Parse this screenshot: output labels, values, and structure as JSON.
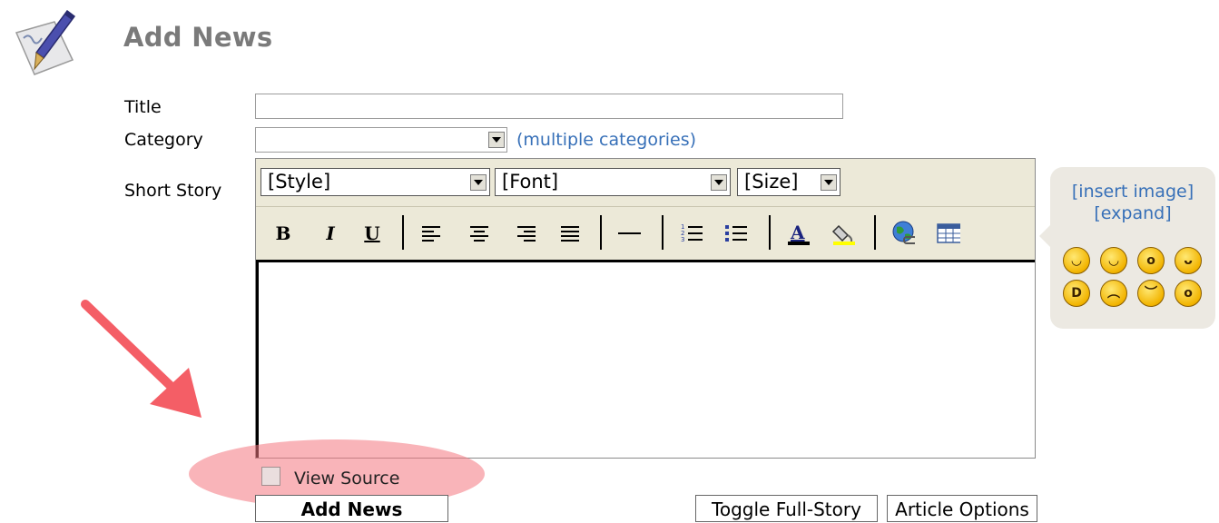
{
  "page": {
    "title": "Add News"
  },
  "form": {
    "title_label": "Title",
    "title_value": "",
    "category_label": "Category",
    "category_value": "",
    "multiple_categories_link": "(multiple categories)",
    "short_story_label": "Short Story"
  },
  "editor": {
    "style_select": "[Style]",
    "font_select": "[Font]",
    "size_select": "[Size]",
    "bold_label": "B",
    "italic_label": "I",
    "underline_label": "U",
    "content": ""
  },
  "side_panel": {
    "insert_image": "[insert image]",
    "expand": "[expand]",
    "smileys": [
      "smile",
      "wink",
      "surprised",
      "tongue",
      "laugh",
      "sad",
      "angry",
      "crying"
    ]
  },
  "view_source": {
    "label": "View Source",
    "checked": false
  },
  "buttons": {
    "add_news": "Add News",
    "toggle_full_story": "Toggle Full-Story",
    "article_options": "Article Options"
  },
  "colors": {
    "link": "#3770b8",
    "title": "#7a7a7a",
    "toolbar_bg": "#ece9d8",
    "highlight": "#f47680",
    "arrow": "#f45e66"
  }
}
